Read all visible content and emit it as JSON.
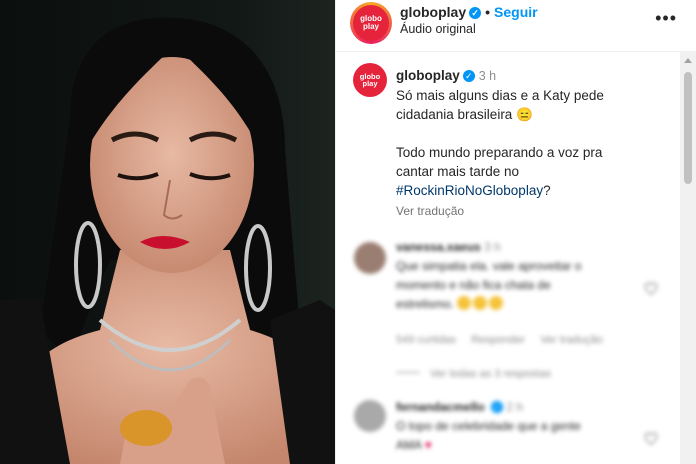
{
  "post": {
    "account": "globoplay",
    "avatar_text_top": "globo",
    "avatar_text_bottom": "play",
    "follow_label": "Seguir",
    "audio_label": "Áudio original",
    "more_icon": "•••"
  },
  "caption": {
    "username": "globoplay",
    "time": "3 h",
    "line1": "Só mais alguns dias e a Katy pede",
    "line2": "cidadania brasileira 😑",
    "line3": "Todo mundo preparando a voz pra",
    "line4": "cantar mais tarde no",
    "hashtag": "#RockinRioNoGloboplay",
    "hashtag_suffix": "?",
    "translate": "Ver tradução"
  },
  "comments": [
    {
      "username": "vanessa.xaeus",
      "time": "3 h",
      "line1": "Que simpatia ela. vale aproveitar o",
      "line2": "momento e não fica chata de",
      "line3": "estrelismo.",
      "meta_likes": "549 curtidas",
      "meta_reply": "Responder",
      "meta_translate": "Ver tradução",
      "replies": "Ver todas as 3 respostas"
    },
    {
      "username": "fernandacmello",
      "time": "2 h",
      "line1": "O topo de celebridade que a gente",
      "line2": "AMA"
    }
  ],
  "colors": {
    "accent": "#0095f6",
    "brand": "#e5243b",
    "hashtag": "#00376b"
  }
}
